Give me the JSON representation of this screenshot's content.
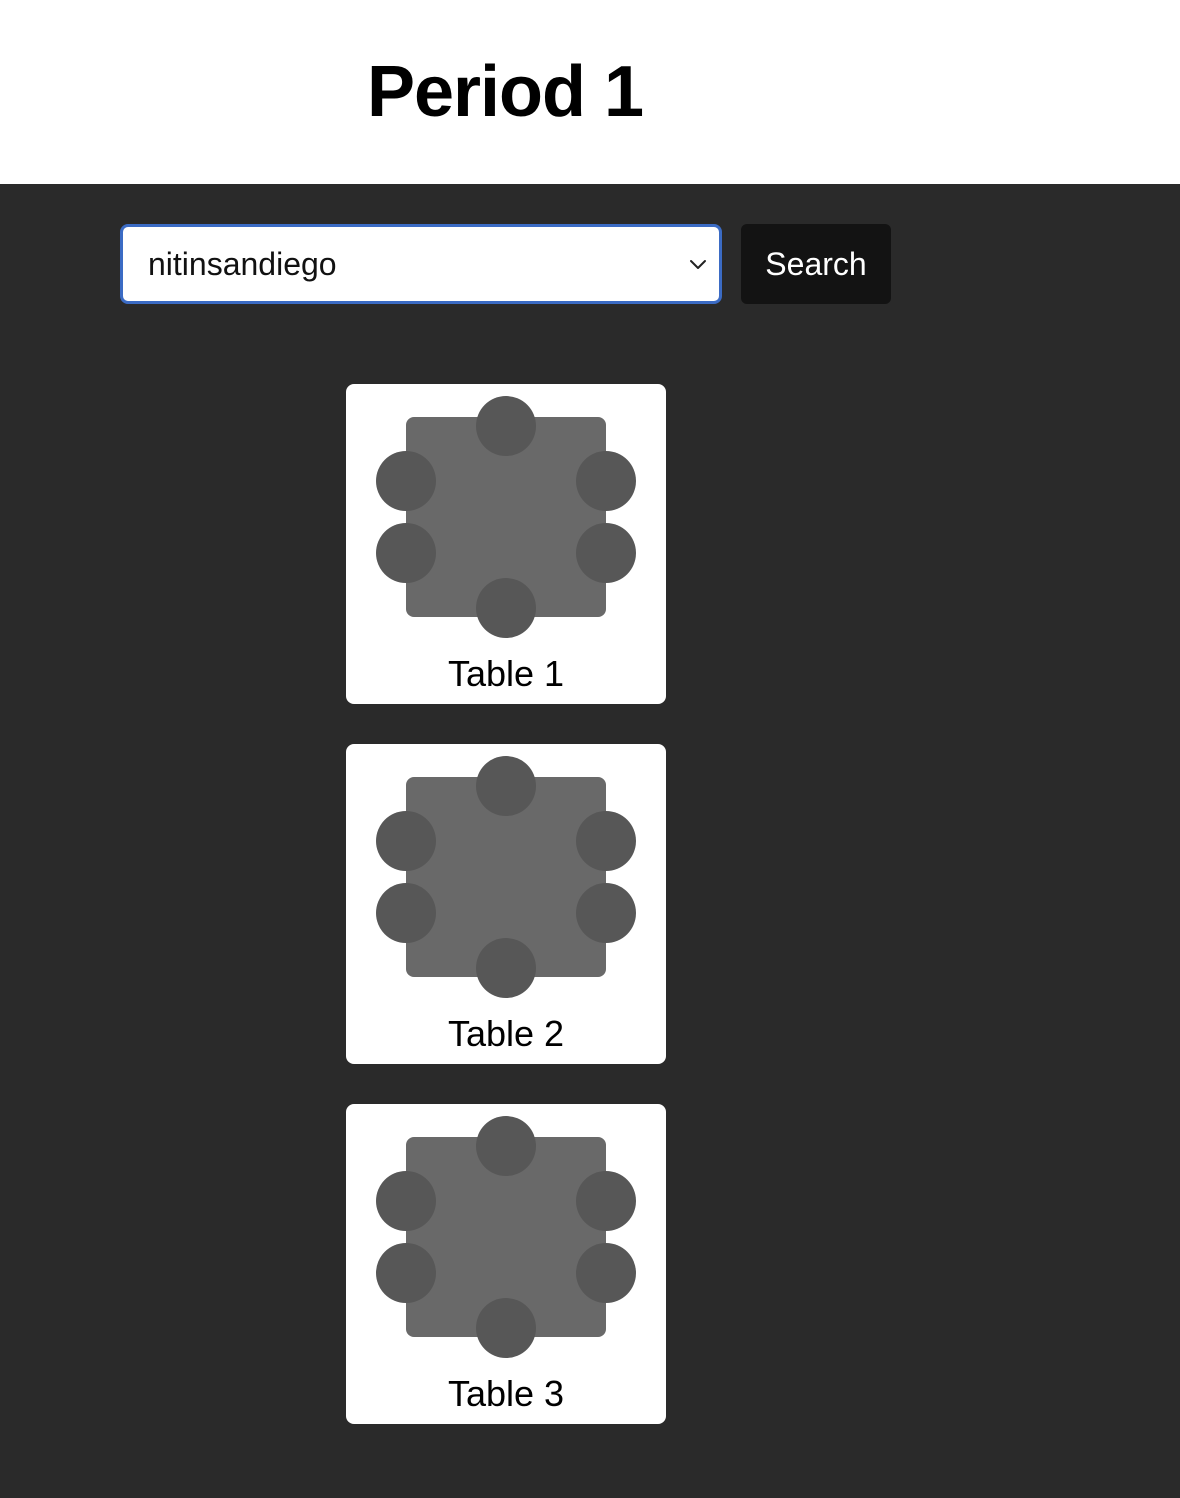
{
  "header": {
    "title": "Period 1"
  },
  "search": {
    "selected_value": "nitinsandiego",
    "button_label": "Search"
  },
  "tables": [
    {
      "label": "Table 1"
    },
    {
      "label": "Table 2"
    },
    {
      "label": "Table 3"
    }
  ],
  "colors": {
    "header_bg": "#ffffff",
    "main_bg": "#2a2a2a",
    "select_border": "#3b6bc4",
    "button_bg": "#131313",
    "table_top": "#696969",
    "seat": "#575757"
  },
  "icons": {
    "select_arrow": "chevron-down-icon",
    "seat": "seat-icon"
  }
}
